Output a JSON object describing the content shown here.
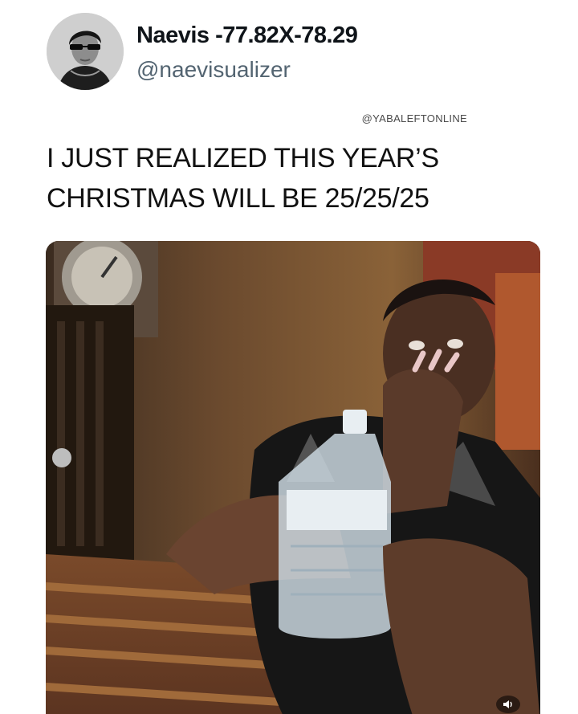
{
  "author": {
    "display_name": "Naevis -77.82X-78.29",
    "handle": "@naevisualizer",
    "avatar_icon": "profile-avatar"
  },
  "watermark": "@YABALEFTONLINE",
  "tweet": {
    "text": "I JUST REALIZED THIS YEAR’S CHRISTMAS WILL BE 25/25/25"
  },
  "media": {
    "type": "video",
    "controls": {
      "volume_icon": "speaker-icon"
    }
  },
  "colors": {
    "text_primary": "#0f1419",
    "text_secondary": "#536471",
    "background": "#ffffff"
  }
}
